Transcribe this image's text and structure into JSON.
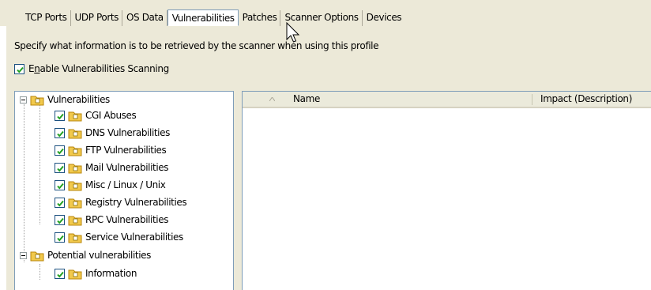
{
  "tabs": [
    {
      "label": "TCP Ports"
    },
    {
      "label": "UDP Ports"
    },
    {
      "label": "OS Data"
    },
    {
      "label": "Vulnerabilities"
    },
    {
      "label": "Patches"
    },
    {
      "label": "Scanner Options"
    },
    {
      "label": "Devices"
    }
  ],
  "active_tab": "Vulnerabilities",
  "description": "Specify what information is to be retrieved by the scanner when using this profile",
  "enable": {
    "label_pre": "E",
    "label_mnemonic": "n",
    "label_post": "able Vulnerabilities Scanning",
    "checked": true
  },
  "tree": {
    "root": "Vulnerabilities",
    "children": [
      "CGI Abuses",
      "DNS Vulnerabilities",
      "FTP Vulnerabilities",
      "Mail Vulnerabilities",
      "Misc / Linux / Unix",
      "Registry Vulnerabilities",
      "RPC Vulnerabilities",
      "Service Vulnerabilities"
    ],
    "root2": "Potential vulnerabilities",
    "children2": [
      "Information"
    ]
  },
  "list": {
    "columns": [
      "Name",
      "Impact (Description)"
    ]
  },
  "colors": {
    "checkmark": "#21a121",
    "folder": "#f2c94c",
    "border": "#7f9db9"
  }
}
